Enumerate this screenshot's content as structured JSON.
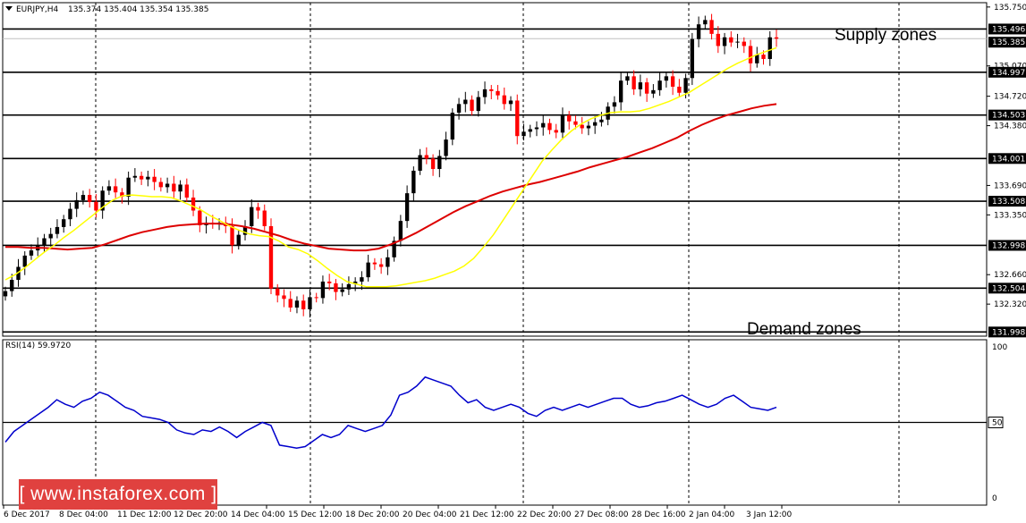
{
  "header": {
    "symbol": "EURJPY,H4",
    "ohlc": "135.374 135.404 135.354 135.385",
    "rsi_label": "RSI(14) 59.9720"
  },
  "annotations": {
    "supply": "Supply zones",
    "demand": "Demand zones"
  },
  "watermark": "[  www.instaforex.com ]",
  "colors": {
    "bull": "#000000",
    "bear": "#ff0000",
    "ma_fast": "#ffff00",
    "ma_slow": "#dd0000",
    "rsi": "#0000cc",
    "tag_bg": "#000000",
    "watermark_bg": "#e0413f"
  },
  "chart_data": {
    "type": "candlestick",
    "price_axis": {
      "min": 131.95,
      "max": 135.8,
      "ticks": [
        135.75,
        135.07,
        134.72,
        134.38,
        133.69,
        133.35,
        132.66,
        132.32
      ]
    },
    "levels": [
      135.496,
      134.997,
      134.503,
      134.001,
      133.508,
      132.998,
      132.504,
      131.998
    ],
    "current_price": 135.385,
    "rsi_axis": {
      "ticks": [
        100,
        50,
        0
      ],
      "level": 50
    },
    "time_labels": [
      "6 Dec 2017",
      "8 Dec 04:00",
      "11 Dec 12:00",
      "12 Dec 20:00",
      "14 Dec 04:00",
      "15 Dec 12:00",
      "18 Dec 20:00",
      "20 Dec 04:00",
      "21 Dec 12:00",
      "22 Dec 20:00",
      "27 Dec 08:00",
      "28 Dec 16:00",
      "2 Jan 04:00",
      "3 Jan 12:00"
    ],
    "closes": [
      132.47,
      132.6,
      132.75,
      132.88,
      132.94,
      133.0,
      133.08,
      133.13,
      133.21,
      133.3,
      133.42,
      133.52,
      133.58,
      133.5,
      133.4,
      133.63,
      133.68,
      133.61,
      133.56,
      133.78,
      133.8,
      133.76,
      133.79,
      133.73,
      133.67,
      133.71,
      133.62,
      133.7,
      133.55,
      133.4,
      133.23,
      133.26,
      133.24,
      133.26,
      133.22,
      133.0,
      133.12,
      133.22,
      133.44,
      133.4,
      133.22,
      132.5,
      132.42,
      132.38,
      132.28,
      132.36,
      132.26,
      132.4,
      132.39,
      132.58,
      132.56,
      132.46,
      132.49,
      132.55,
      132.58,
      132.63,
      132.8,
      132.78,
      132.75,
      132.86,
      133.05,
      133.28,
      133.6,
      133.86,
      134.04,
      134.0,
      133.88,
      134.03,
      134.22,
      134.53,
      134.63,
      134.68,
      134.55,
      134.71,
      134.8,
      134.78,
      134.73,
      134.63,
      134.67,
      134.26,
      134.31,
      134.34,
      134.36,
      134.41,
      134.33,
      134.3,
      134.5,
      134.43,
      134.39,
      134.35,
      134.38,
      134.42,
      134.45,
      134.6,
      134.65,
      134.9,
      134.95,
      134.8,
      134.88,
      134.75,
      134.79,
      134.9,
      134.95,
      134.83,
      134.76,
      134.93,
      135.38,
      135.55,
      135.6,
      135.44,
      135.3,
      135.4,
      135.34,
      135.35,
      135.3,
      135.1,
      135.2,
      135.15,
      135.4,
      135.385
    ],
    "ma_fast_values": [
      132.6,
      132.66,
      132.74,
      132.83,
      132.92,
      133.0,
      133.09,
      133.17,
      133.26,
      133.35,
      133.44,
      133.52,
      133.57,
      133.58,
      133.57,
      133.56,
      133.56,
      133.55,
      133.51,
      133.46,
      133.41,
      133.34,
      133.28,
      133.22,
      133.17,
      133.13,
      133.11,
      133.1,
      133.05,
      132.98,
      132.95,
      132.9,
      132.82,
      132.73,
      132.65,
      132.58,
      132.55,
      132.52,
      132.52,
      132.52,
      132.53,
      132.55,
      132.57,
      132.59,
      132.62,
      132.66,
      132.7,
      132.76,
      132.85,
      132.98,
      133.12,
      133.29,
      133.46,
      133.63,
      133.8,
      133.97,
      134.1,
      134.22,
      134.32,
      134.4,
      134.46,
      134.5,
      134.53,
      134.54,
      134.54,
      134.55,
      134.58,
      134.62,
      134.66,
      134.71,
      134.76,
      134.83,
      134.9,
      134.97,
      135.04,
      135.1,
      135.15,
      135.2,
      135.24,
      135.28
    ],
    "ma_slow_values": [
      132.98,
      132.98,
      132.97,
      132.97,
      132.96,
      132.95,
      132.96,
      132.97,
      133.01,
      133.06,
      133.11,
      133.15,
      133.18,
      133.21,
      133.23,
      133.24,
      133.25,
      133.25,
      133.24,
      133.22,
      133.19,
      133.15,
      133.11,
      133.06,
      133.02,
      132.99,
      132.96,
      132.95,
      132.94,
      132.94,
      132.96,
      133.01,
      133.07,
      133.14,
      133.22,
      133.3,
      133.38,
      133.45,
      133.51,
      133.57,
      133.62,
      133.66,
      133.7,
      133.73,
      133.77,
      133.81,
      133.85,
      133.9,
      133.94,
      133.98,
      134.02,
      134.07,
      134.12,
      134.18,
      134.24,
      134.32,
      134.39,
      134.45,
      134.5,
      134.54,
      134.58,
      134.61,
      134.63
    ],
    "rsi_values": [
      37,
      44,
      48,
      52,
      56,
      60,
      65,
      62,
      60,
      64,
      66,
      70,
      68,
      64,
      60,
      58,
      54,
      53,
      52,
      50,
      45,
      43,
      42,
      45,
      44,
      47,
      44,
      40,
      44,
      47,
      50,
      48,
      35,
      34,
      33,
      34,
      38,
      42,
      40,
      42,
      48,
      46,
      44,
      46,
      48,
      55,
      68,
      70,
      74,
      80,
      78,
      76,
      74,
      68,
      63,
      65,
      60,
      58,
      60,
      62,
      60,
      56,
      54,
      58,
      60,
      58,
      60,
      62,
      60,
      62,
      64,
      66,
      66,
      62,
      60,
      61,
      63,
      64,
      66,
      68,
      65,
      62,
      60,
      62,
      66,
      68,
      64,
      60,
      59,
      58,
      60
    ]
  }
}
